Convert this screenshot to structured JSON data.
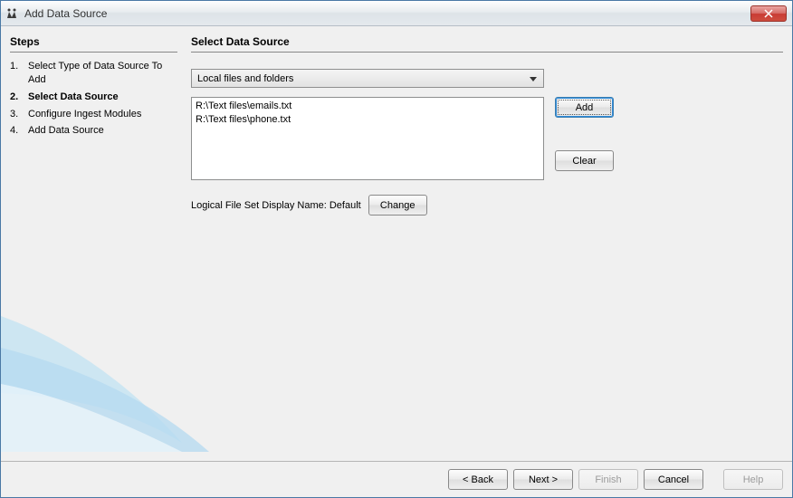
{
  "window": {
    "title": "Add Data Source"
  },
  "sidebar": {
    "header": "Steps",
    "items": [
      {
        "num": "1.",
        "label": "Select Type of Data Source To Add",
        "active": false
      },
      {
        "num": "2.",
        "label": "Select Data Source",
        "active": true
      },
      {
        "num": "3.",
        "label": "Configure Ingest Modules",
        "active": false
      },
      {
        "num": "4.",
        "label": "Add Data Source",
        "active": false
      }
    ]
  },
  "main": {
    "header": "Select Data Source",
    "source_type": "Local files and folders",
    "files": [
      "R:\\Text files\\emails.txt",
      "R:\\Text files\\phone.txt"
    ],
    "add_label": "Add",
    "clear_label": "Clear",
    "display_name_prefix": "Logical File Set Display Name: ",
    "display_name_value": "Default",
    "change_label": "Change"
  },
  "footer": {
    "back_label": "< Back",
    "next_label": "Next >",
    "finish_label": "Finish",
    "cancel_label": "Cancel",
    "help_label": "Help"
  }
}
